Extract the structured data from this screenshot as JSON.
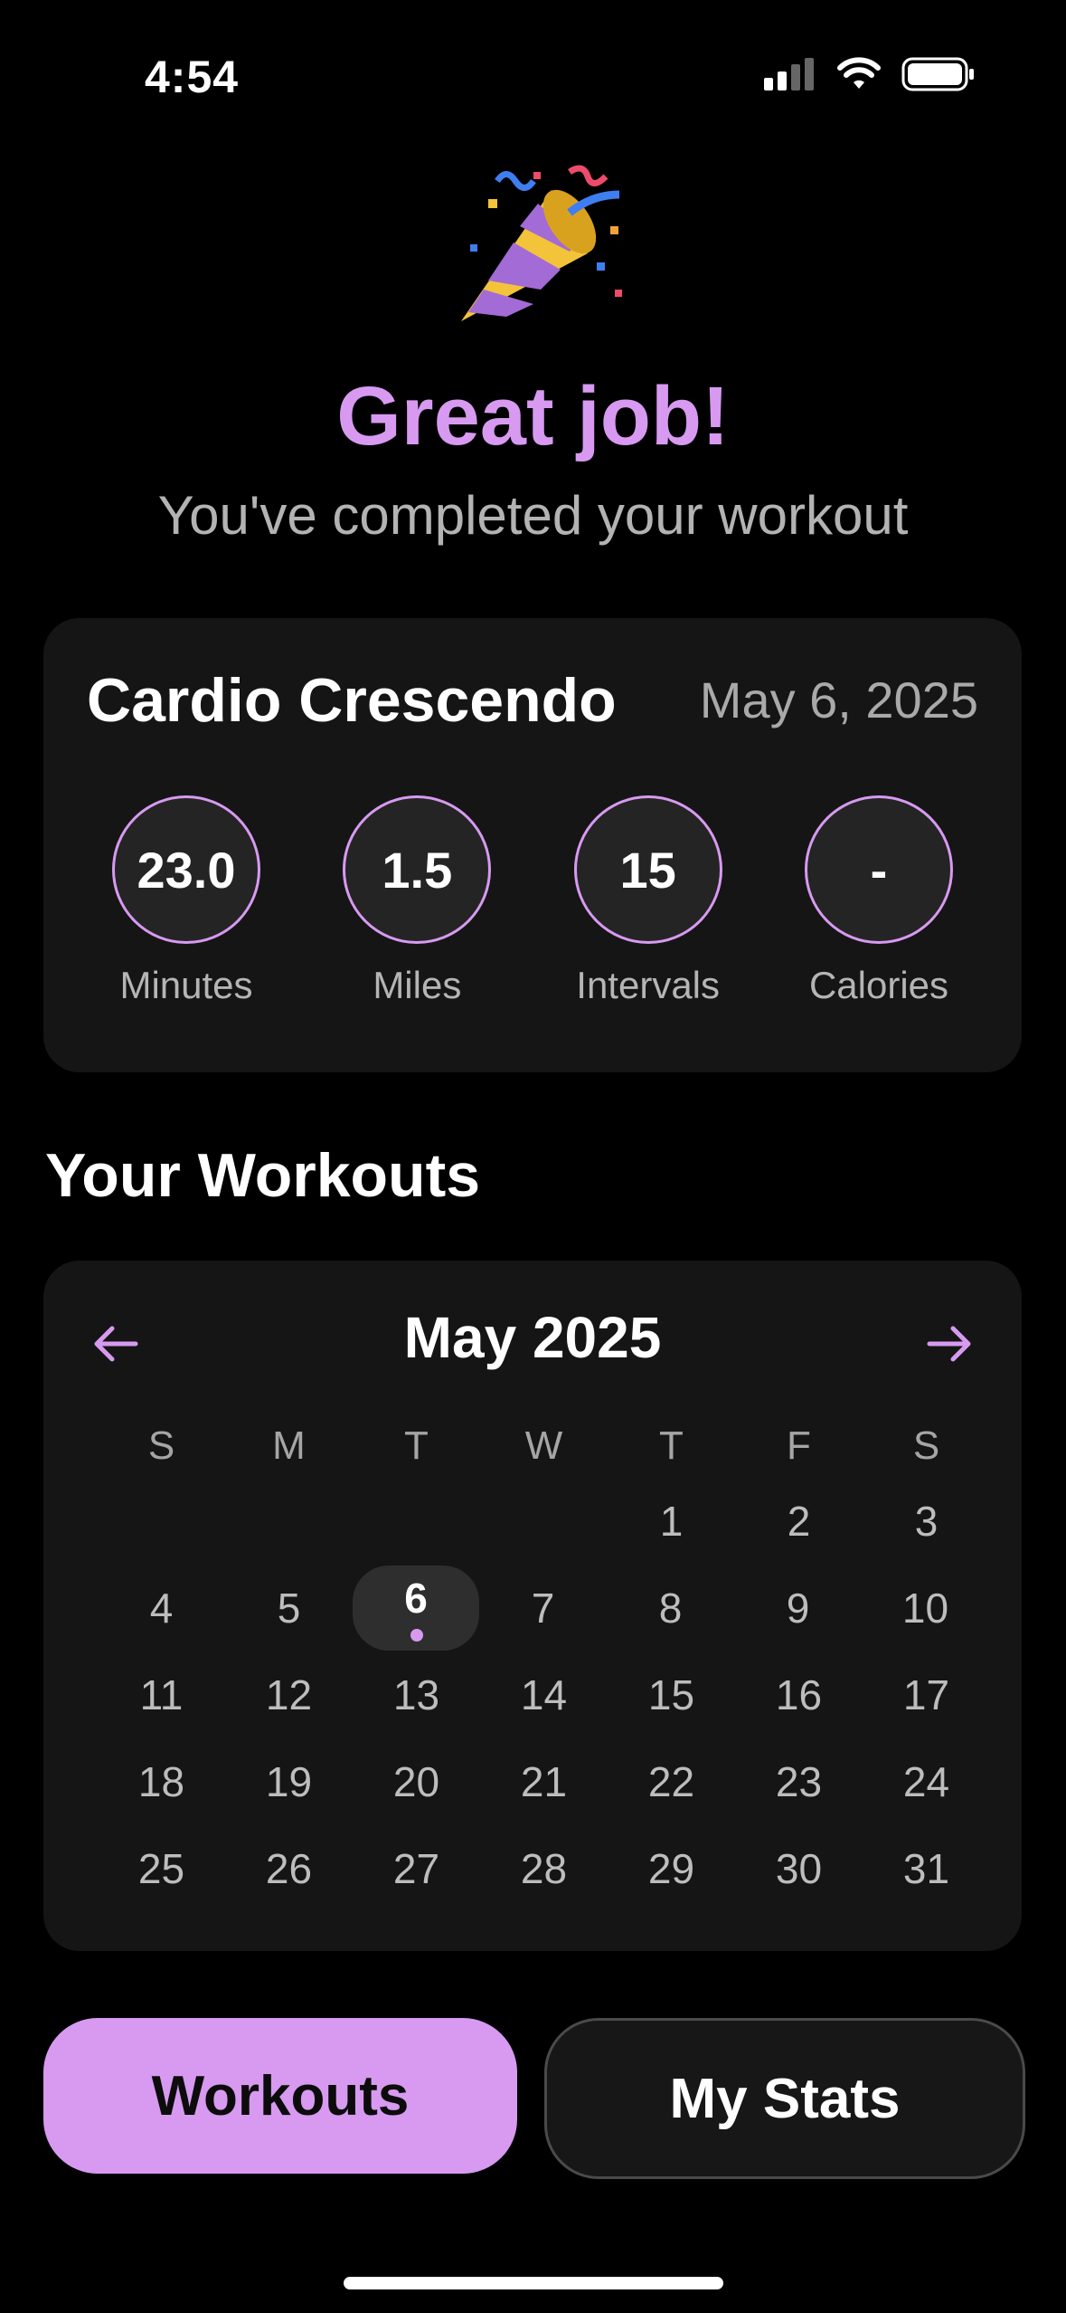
{
  "status_bar": {
    "time": "4:54"
  },
  "hero": {
    "title": "Great job!",
    "subtitle": "You've completed your workout",
    "emoji_icon": "party-popper-icon"
  },
  "summary": {
    "name": "Cardio Crescendo",
    "date": "May 6, 2025",
    "stats": [
      {
        "value": "23.0",
        "label": "Minutes"
      },
      {
        "value": "1.5",
        "label": "Miles"
      },
      {
        "value": "15",
        "label": "Intervals"
      },
      {
        "value": "-",
        "label": "Calories"
      }
    ]
  },
  "section_title": "Your Workouts",
  "calendar": {
    "month": "May 2025",
    "weekdays": [
      "S",
      "M",
      "T",
      "W",
      "T",
      "F",
      "S"
    ],
    "weeks": [
      [
        "",
        "",
        "",
        "",
        "1",
        "2",
        "3"
      ],
      [
        "4",
        "5",
        "6",
        "7",
        "8",
        "9",
        "10"
      ],
      [
        "11",
        "12",
        "13",
        "14",
        "15",
        "16",
        "17"
      ],
      [
        "18",
        "19",
        "20",
        "21",
        "22",
        "23",
        "24"
      ],
      [
        "25",
        "26",
        "27",
        "28",
        "29",
        "30",
        "31"
      ]
    ],
    "selected_day": "6"
  },
  "buttons": {
    "workouts": "Workouts",
    "stats": "My Stats"
  },
  "colors": {
    "accent": "#d79af0",
    "card": "#151515",
    "background": "#000000"
  }
}
